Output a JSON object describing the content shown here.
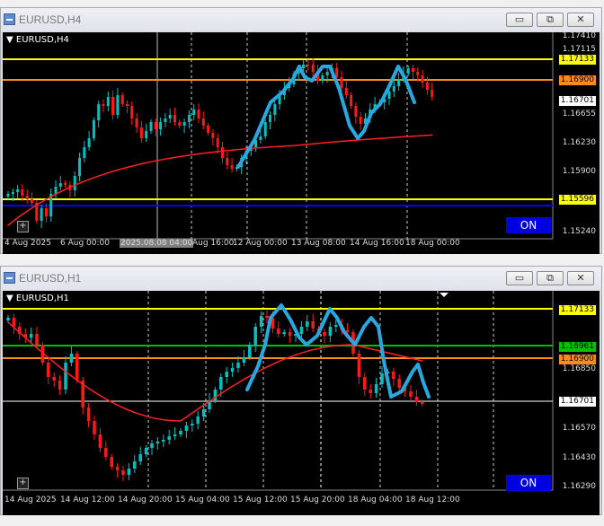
{
  "charts": [
    {
      "window_title": "EURUSD,H4",
      "symbol_label": "EURUSD,H4",
      "on_label": "ON",
      "buttons": {
        "minimize": "▭",
        "restore": "⧉",
        "close": "✕"
      },
      "price_ticks": [
        "1.17410",
        "1.17115",
        "1.16655",
        "1.16230",
        "1.15900",
        "1.15240"
      ],
      "price_labels": [
        {
          "text": "1.17133",
          "bg": "#ffff00",
          "fg": "#000000"
        },
        {
          "text": "1.16900",
          "bg": "#ff8c1a",
          "fg": "#000000"
        },
        {
          "text": "1.16701",
          "bg": "#ffffff",
          "fg": "#000000"
        },
        {
          "text": "1.15596",
          "bg": "#ffff00",
          "fg": "#000000"
        }
      ],
      "time_ticks": [
        "4 Aug 2025",
        "6 Aug 00:00",
        "2025.08.08 04:00",
        "Aug 16:00",
        "12 Aug 00:00",
        "13 Aug 08:00",
        "14 Aug 16:00",
        "18 Aug 00:00"
      ]
    },
    {
      "window_title": "EURUSD,H1",
      "symbol_label": "EURUSD,H1",
      "on_label": "ON",
      "buttons": {
        "minimize": "▭",
        "restore": "⧉",
        "close": "✕"
      },
      "price_ticks": [
        "1.16850",
        "1.16570",
        "1.16430",
        "1.16290"
      ],
      "price_labels": [
        {
          "text": "1.17133",
          "bg": "#ffff00",
          "fg": "#000000"
        },
        {
          "text": "1.16961",
          "bg": "#00c000",
          "fg": "#000000"
        },
        {
          "text": "1.16900",
          "bg": "#ff8c1a",
          "fg": "#000000"
        },
        {
          "text": "1.16701",
          "bg": "#ffffff",
          "fg": "#000000"
        }
      ],
      "time_ticks": [
        "14 Aug 2025",
        "14 Aug 12:00",
        "14 Aug 20:00",
        "15 Aug 04:00",
        "15 Aug 12:00",
        "15 Aug 20:00",
        "18 Aug 04:00",
        "18 Aug 12:00"
      ]
    }
  ],
  "colors": {
    "bull": "#00c0c0",
    "bear": "#ff1a1a",
    "ma": "#ff2020",
    "pattern": "#29a8e0",
    "grid": "#ffffff",
    "yellow": "#ffff00",
    "orange": "#ff8c1a",
    "green": "#00c000",
    "blue": "#0000ff"
  }
}
